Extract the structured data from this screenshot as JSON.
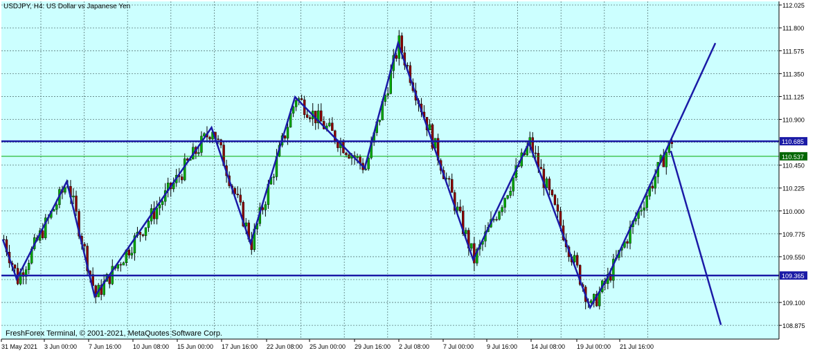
{
  "window": {
    "title": "USDJPY, H4:  US Dollar vs Japanese Yen",
    "copyright": "FreshForex Terminal, © 2001-2021, MetaQuotes Software Corp."
  },
  "colors": {
    "background": "#ccffff",
    "grid": "#5a7a7a",
    "bull_candle": "#00aa00",
    "bear_candle": "#8b0000",
    "wick": "#000000",
    "trend_lines": "#1a1aa6",
    "current_price_line": "#00aa00",
    "axis_text": "#000000"
  },
  "chart_data": {
    "type": "candlestick",
    "symbol": "USDJPY",
    "timeframe": "H4",
    "y_ticks": [
      "112.025",
      "111.800",
      "111.575",
      "111.350",
      "111.125",
      "110.900",
      "110.685",
      "110.450",
      "110.225",
      "110.000",
      "109.775",
      "109.550",
      "109.365",
      "109.100",
      "108.875"
    ],
    "ylim": [
      108.74,
      112.06
    ],
    "x_ticks": [
      "31 May 2021",
      "3 Jun 00:00",
      "7 Jun 16:00",
      "10 Jun 08:00",
      "15 Jun 00:00",
      "17 Jun 16:00",
      "22 Jun 08:00",
      "25 Jun 00:00",
      "29 Jun 16:00",
      "2 Jul 08:00",
      "7 Jul 00:00",
      "9 Jul 16:00",
      "14 Jul 08:00",
      "19 Jul 00:00",
      "21 Jul 16:00"
    ],
    "levels": [
      {
        "label": "110.685",
        "price": 110.685,
        "kind": "resistance"
      },
      {
        "label": "109.365",
        "price": 109.365,
        "kind": "support"
      }
    ],
    "current_price": {
      "label": "110.537",
      "price": 110.537
    },
    "wave_points": [
      {
        "bar": 0,
        "price": 109.72
      },
      {
        "bar": 5,
        "price": 109.33
      },
      {
        "bar": 23,
        "price": 110.29
      },
      {
        "bar": 33,
        "price": 109.16
      },
      {
        "bar": 75,
        "price": 110.82
      },
      {
        "bar": 89,
        "price": 109.68
      },
      {
        "bar": 105,
        "price": 111.12
      },
      {
        "bar": 130,
        "price": 110.42
      },
      {
        "bar": 142,
        "price": 111.65
      },
      {
        "bar": 169,
        "price": 109.52
      },
      {
        "bar": 189,
        "price": 110.67
      },
      {
        "bar": 211,
        "price": 109.05
      },
      {
        "bar": 217,
        "price": 109.33
      },
      {
        "bar": 256,
        "price": 111.65
      }
    ],
    "projection_points": [
      {
        "bar": 240,
        "price": 110.59
      },
      {
        "bar": 258,
        "price": 108.88
      }
    ]
  }
}
